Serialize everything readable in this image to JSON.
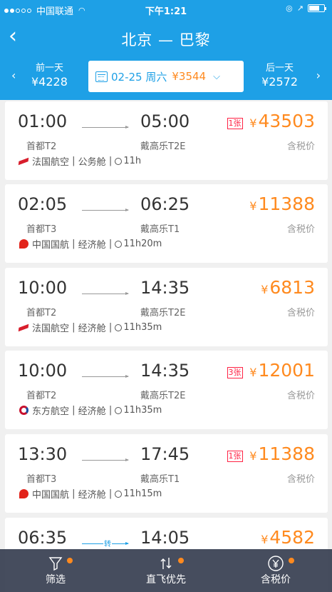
{
  "status": {
    "carrier": "中国联通",
    "time": "下午1:21",
    "battery_level": 0.7
  },
  "nav": {
    "title": "北京 — 巴黎"
  },
  "date_bar": {
    "prev_label": "前一天",
    "prev_price": "¥4228",
    "date": "02-25 周六",
    "price": "¥3544",
    "next_label": "后一天",
    "next_price": "¥2572"
  },
  "flights": [
    {
      "dep": "01:00",
      "arr": "05:00",
      "dep_term": "首都T2",
      "arr_term": "戴高乐T2E",
      "tickets": "1张",
      "price": "43503",
      "tax": "含税价",
      "airline": "法国航空",
      "cabin": "公务舱",
      "duration": "11h",
      "logo": "af"
    },
    {
      "dep": "02:05",
      "arr": "06:25",
      "dep_term": "首都T3",
      "arr_term": "戴高乐T1",
      "tickets": "",
      "price": "11388",
      "tax": "含税价",
      "airline": "中国国航",
      "cabin": "经济舱",
      "duration": "11h20m",
      "logo": "ca"
    },
    {
      "dep": "10:00",
      "arr": "14:35",
      "dep_term": "首都T2",
      "arr_term": "戴高乐T2E",
      "tickets": "",
      "price": "6813",
      "tax": "含税价",
      "airline": "法国航空",
      "cabin": "经济舱",
      "duration": "11h35m",
      "logo": "af"
    },
    {
      "dep": "10:00",
      "arr": "14:35",
      "dep_term": "首都T2",
      "arr_term": "戴高乐T2E",
      "tickets": "3张",
      "price": "12001",
      "tax": "含税价",
      "airline": "东方航空",
      "cabin": "经济舱",
      "duration": "11h35m",
      "logo": "ce"
    },
    {
      "dep": "13:30",
      "arr": "17:45",
      "dep_term": "首都T3",
      "arr_term": "戴高乐T1",
      "tickets": "1张",
      "price": "11388",
      "tax": "含税价",
      "airline": "中国国航",
      "cabin": "经济舱",
      "duration": "11h15m",
      "logo": "ca"
    },
    {
      "dep": "06:35",
      "arr": "14:05",
      "dep_term": "",
      "arr_term": "",
      "tickets": "",
      "price": "4582",
      "tax": "",
      "airline": "",
      "cabin": "",
      "duration": "",
      "logo": "",
      "transfer": "转"
    }
  ],
  "bottom": {
    "filter": "筛选",
    "direct": "直飞优先",
    "tax": "含税价"
  },
  "icons": {
    "back": "back-chevron-icon",
    "calendar": "calendar-icon",
    "filter": "filter-funnel-icon",
    "sort": "sort-arrows-icon",
    "yen": "yen-circle-icon"
  },
  "colors": {
    "brand": "#1ea0e6",
    "price": "#ff8a1f",
    "ticket_badge": "#ff2244"
  }
}
